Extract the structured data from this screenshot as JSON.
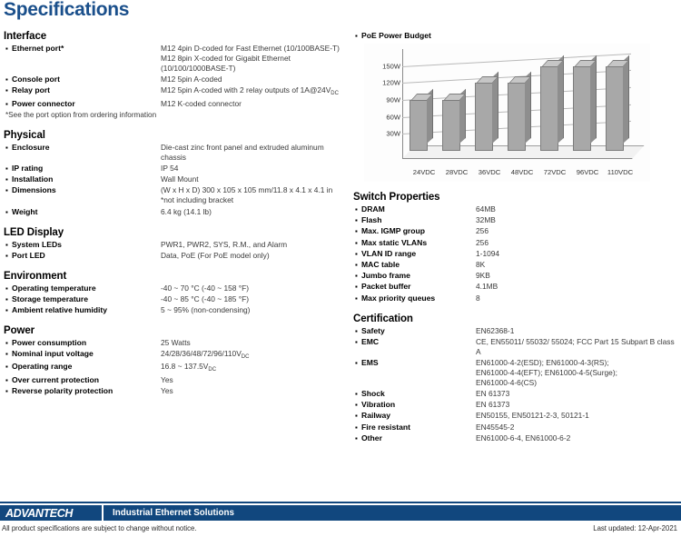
{
  "page_title": "Specifications",
  "colors": {
    "brand_navy": "#11477e",
    "title_blue": "#1a4f8b",
    "bar_gray": "#a8a8a8"
  },
  "left_column": [
    {
      "heading": "Interface",
      "rows": [
        {
          "label": "Ethernet port*",
          "value": "M12 4pin D-coded for Fast Ethernet (10/100BASE-T)\nM12 8pin X-coded for Gigabit Ethernet\n(10/100/1000BASE-T)"
        },
        {
          "label": "Console port",
          "value": "M12 5pin A-coded"
        },
        {
          "label": "Relay port",
          "value": "M12 5pin A-coded with 2 relay outputs of 1A@24V",
          "sub": "DC"
        },
        {
          "label": "Power connector",
          "value": "M12 K-coded connector"
        }
      ],
      "note": "*See the port option from ordering information"
    },
    {
      "heading": "Physical",
      "rows": [
        {
          "label": "Enclosure",
          "value": "Die-cast zinc front panel and extruded aluminum\nchassis"
        },
        {
          "label": "IP rating",
          "value": "IP 54"
        },
        {
          "label": "Installation",
          "value": "Wall Mount"
        },
        {
          "label": "Dimensions",
          "value": "(W x H x D) 300 x 105 x 105 mm/11.8 x 4.1 x 4.1 in\n*not including bracket"
        },
        {
          "label": "Weight",
          "value": "6.4 kg (14.1 lb)"
        }
      ]
    },
    {
      "heading": "LED Display",
      "rows": [
        {
          "label": "System LEDs",
          "value": "PWR1, PWR2, SYS, R.M., and Alarm"
        },
        {
          "label": "Port LED",
          "value": "Data, PoE (For PoE model only)"
        }
      ]
    },
    {
      "heading": "Environment",
      "rows": [
        {
          "label": "Operating temperature",
          "value": "-40 ~ 70 °C (-40 ~ 158 °F)"
        },
        {
          "label": "Storage temperature",
          "value": "-40 ~ 85 °C (-40 ~ 185 °F)"
        },
        {
          "label": "Ambient relative humidity",
          "value": "5 ~ 95% (non-condensing)"
        }
      ]
    },
    {
      "heading": "Power",
      "rows": [
        {
          "label": "Power consumption",
          "value": "25 Watts"
        },
        {
          "label": "Nominal input voltage",
          "value": "24/28/36/48/72/96/110V",
          "sub": "DC"
        },
        {
          "label": "Operating range",
          "value": "16.8 ~ 137.5V",
          "sub": "DC"
        },
        {
          "label": "Over current protection",
          "value": "Yes"
        },
        {
          "label": "Reverse polarity protection",
          "value": "Yes"
        }
      ]
    }
  ],
  "chart_title": "PoE Power Budget",
  "chart_data": {
    "type": "bar",
    "title": "PoE Power Budget",
    "categories": [
      "24VDC",
      "28VDC",
      "36VDC",
      "48VDC",
      "72VDC",
      "96VDC",
      "110VDC"
    ],
    "values": [
      90,
      90,
      120,
      120,
      150,
      150,
      150
    ],
    "ytick_labels": [
      "150W",
      "120W",
      "90W",
      "60W",
      "30W"
    ],
    "ytick_values": [
      150,
      120,
      90,
      60,
      30
    ],
    "ylim": [
      0,
      180
    ],
    "xlabel": "",
    "ylabel": "",
    "grid": true,
    "legend": "none"
  },
  "right_column": [
    {
      "heading": "Switch Properties",
      "rows": [
        {
          "label": "DRAM",
          "value": "64MB"
        },
        {
          "label": "Flash",
          "value": "32MB"
        },
        {
          "label": "Max. IGMP group",
          "value": "256"
        },
        {
          "label": "Max static VLANs",
          "value": "256"
        },
        {
          "label": "VLAN ID range",
          "value": "1-1094"
        },
        {
          "label": "MAC table",
          "value": "8K"
        },
        {
          "label": "Jumbo frame",
          "value": "9KB"
        },
        {
          "label": "Packet buffer",
          "value": "4.1MB"
        },
        {
          "label": "Max priority queues",
          "value": "8"
        }
      ]
    },
    {
      "heading": "Certification",
      "rows": [
        {
          "label": "Safety",
          "value": "EN62368-1"
        },
        {
          "label": "EMC",
          "value": "CE, EN55011/ 55032/ 55024; FCC Part 15 Subpart B class A"
        },
        {
          "label": "EMS",
          "value": "EN61000-4-2(ESD); EN61000-4-3(RS);\nEN61000-4-4(EFT); EN61000-4-5(Surge);\nEN61000-4-6(CS)"
        },
        {
          "label": "Shock",
          "value": "EN 61373"
        },
        {
          "label": "Vibration",
          "value": "EN 61373"
        },
        {
          "label": "Railway",
          "value": "EN50155, EN50121-2-3, 50121-1"
        },
        {
          "label": "Fire resistant",
          "value": "EN45545-2"
        },
        {
          "label": "Other",
          "value": "EN61000-6-4, EN61000-6-2"
        }
      ]
    }
  ],
  "footer": {
    "logo": "ADVANTECH",
    "tagline": "Industrial Ethernet Solutions",
    "disclaimer": "All product specifications are subject to change without notice.",
    "last_updated": "Last updated: 12-Apr-2021"
  }
}
